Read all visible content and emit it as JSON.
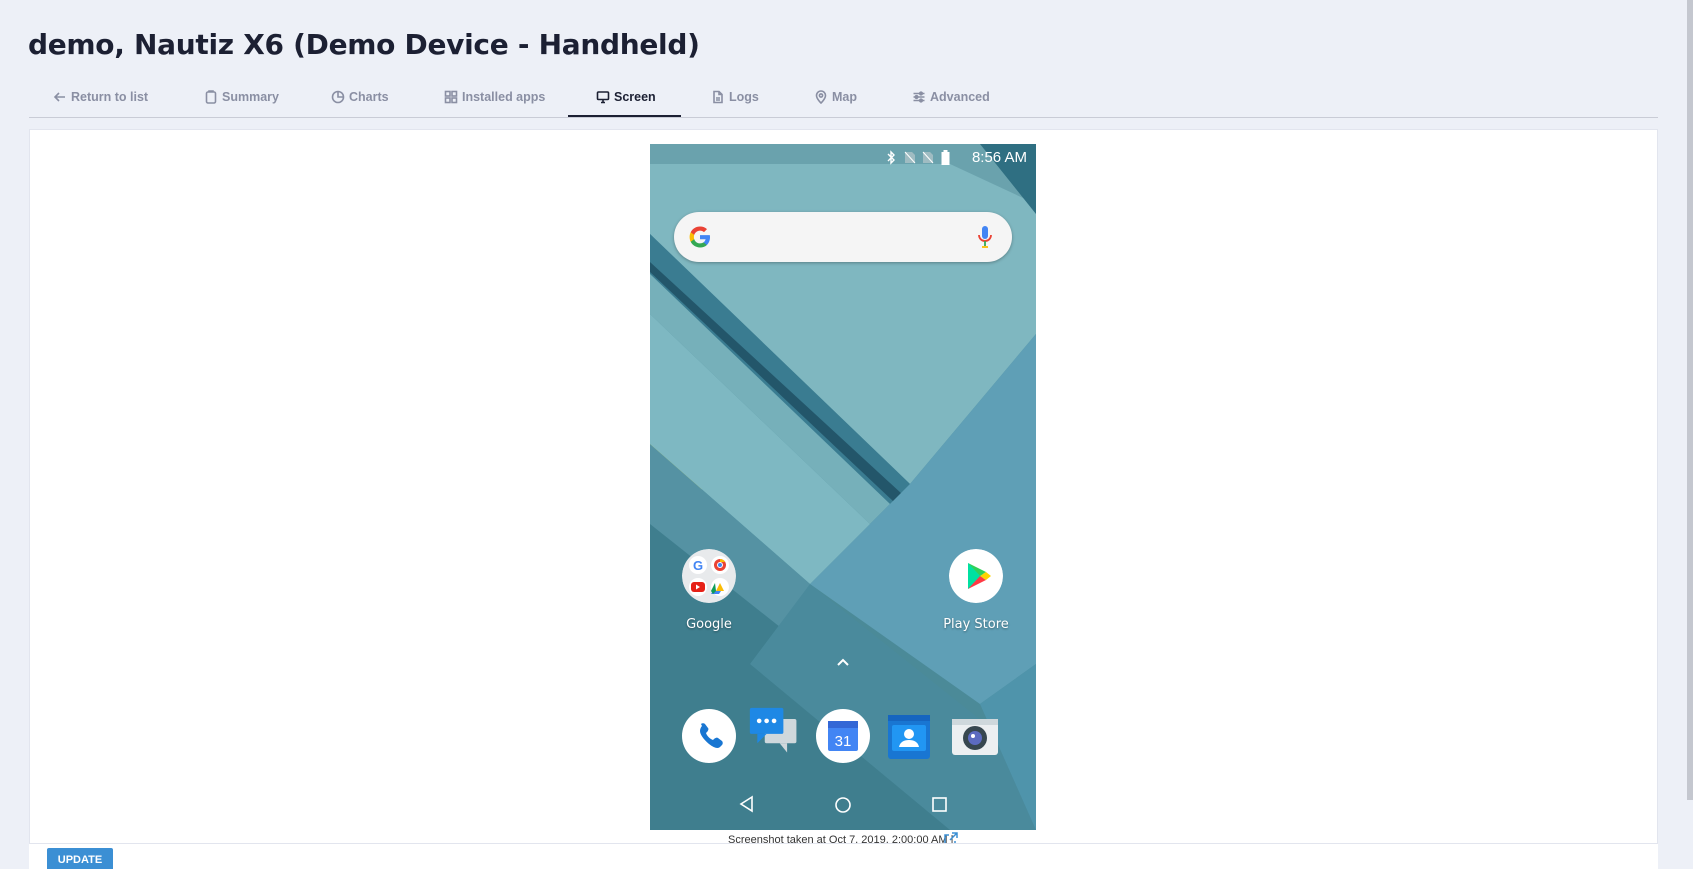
{
  "page": {
    "title": "demo, Nautiz X6 (Demo Device - Handheld)"
  },
  "tabs": [
    {
      "label": "Return to list",
      "icon": "arrow-left-icon"
    },
    {
      "label": "Summary",
      "icon": "clipboard-icon"
    },
    {
      "label": "Charts",
      "icon": "pie-chart-icon"
    },
    {
      "label": "Installed apps",
      "icon": "grid-icon"
    },
    {
      "label": "Screen",
      "icon": "monitor-icon",
      "active": true
    },
    {
      "label": "Logs",
      "icon": "file-icon"
    },
    {
      "label": "Map",
      "icon": "map-pin-icon"
    },
    {
      "label": "Advanced",
      "icon": "sliders-icon"
    }
  ],
  "device_screen": {
    "clock": "8:56 AM",
    "status_icons": [
      "bluetooth-icon",
      "no-sim-icon",
      "no-sim-icon",
      "battery-icon"
    ],
    "home_apps": [
      {
        "label": "Google",
        "icon": "google-folder-icon"
      },
      {
        "label": "Play Store",
        "icon": "play-store-icon"
      }
    ],
    "dock": [
      {
        "icon": "phone-icon"
      },
      {
        "icon": "messages-icon"
      },
      {
        "icon": "calendar-icon",
        "day": "31"
      },
      {
        "icon": "contacts-icon"
      },
      {
        "icon": "camera-icon"
      }
    ],
    "nav": [
      "back-icon",
      "home-icon",
      "recents-icon"
    ]
  },
  "caption": "Screenshot taken at Oct 7, 2019, 2:00:00 AM |",
  "update_label": "UPDATE",
  "colors": {
    "accent": "#3b8fd4",
    "title": "#1c2033",
    "tab_inactive": "#8a8fa3",
    "page_bg": "#edf0f7",
    "wallpaper_teal": "#4f8e9c"
  }
}
